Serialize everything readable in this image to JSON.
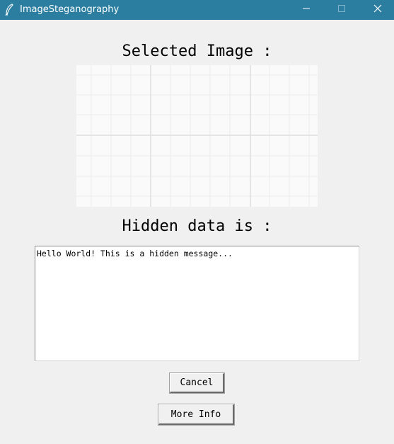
{
  "window": {
    "title": "ImageSteganography",
    "app_icon": "feather-icon",
    "controls": {
      "minimize_icon": "minimize-icon",
      "maximize_icon": "maximize-icon",
      "close_icon": "close-icon"
    },
    "titlebar_color": "#2b7ea0",
    "background_color": "#f0f0f0"
  },
  "main": {
    "selected_image_heading": "Selected Image :",
    "image_preview": {
      "description": "light grid pattern image",
      "grid_color": "#e6e6e6"
    },
    "hidden_data_heading": "Hidden data is :",
    "hidden_data_text": "Hello World! This is a hidden message...",
    "buttons": {
      "cancel_label": "Cancel",
      "more_info_label": "More Info"
    }
  }
}
